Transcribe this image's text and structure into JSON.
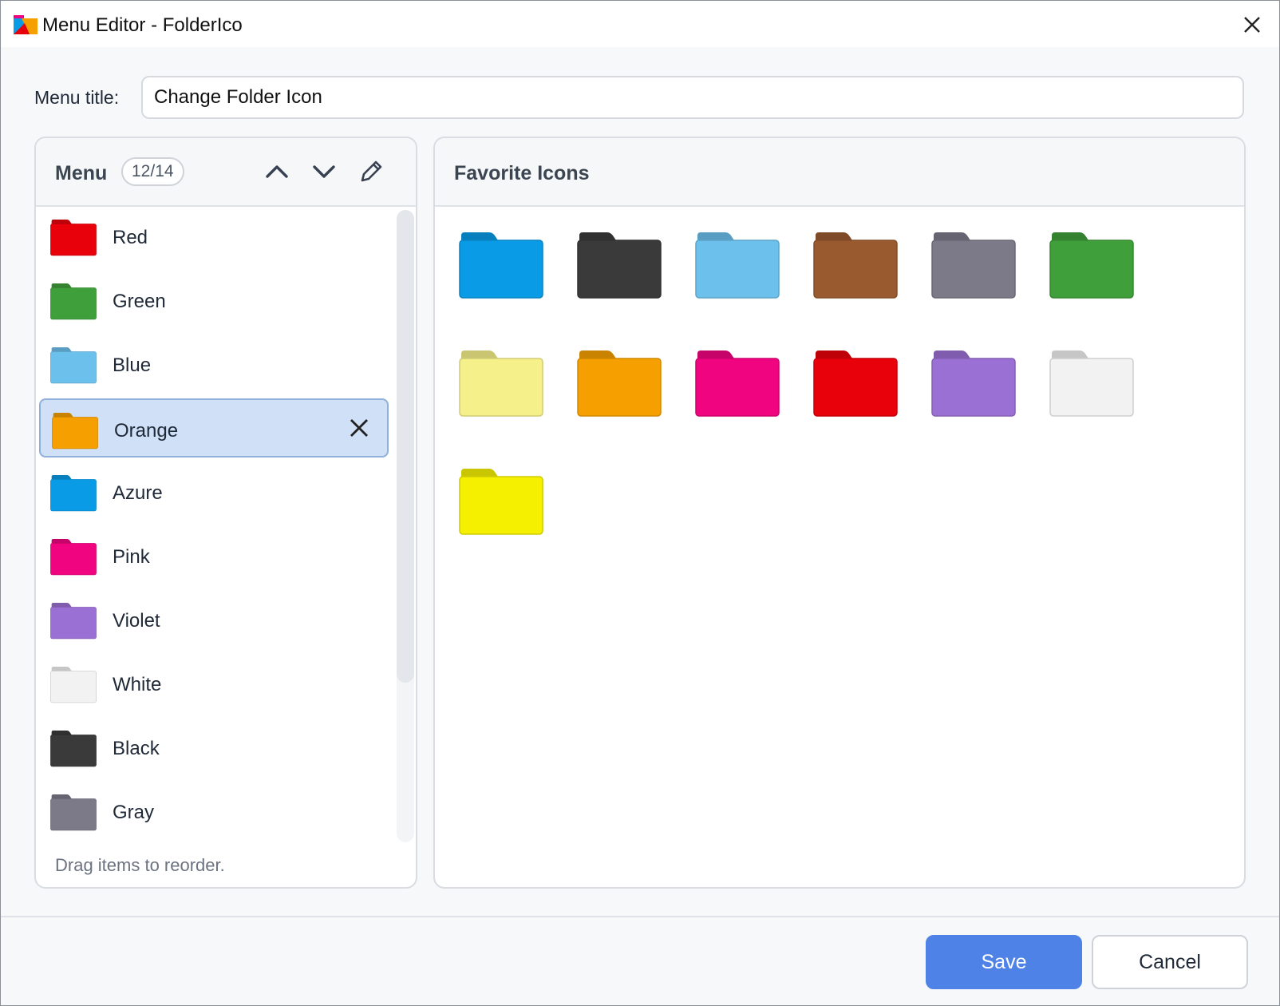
{
  "window": {
    "title": "Menu Editor - FolderIco",
    "close_icon": "close-icon"
  },
  "menu_title": {
    "label": "Menu title:",
    "value": "Change Folder Icon"
  },
  "menu_panel": {
    "header": "Menu",
    "count": "12/14",
    "icons": [
      "chevron-up-icon",
      "chevron-down-icon",
      "pencil-icon"
    ],
    "selected_index": 3,
    "items": [
      {
        "label": "Red",
        "color": "#e8000b"
      },
      {
        "label": "Green",
        "color": "#3f9f3a"
      },
      {
        "label": "Blue",
        "color": "#6cc1ec"
      },
      {
        "label": "Orange",
        "color": "#f5a000"
      },
      {
        "label": "Azure",
        "color": "#0a9be7"
      },
      {
        "label": "Pink",
        "color": "#f0047f"
      },
      {
        "label": "Violet",
        "color": "#9b70d4"
      },
      {
        "label": "White",
        "color": "#f2f2f2"
      },
      {
        "label": "Black",
        "color": "#3a3a3a"
      },
      {
        "label": "Gray",
        "color": "#7c7a88"
      }
    ],
    "hint": "Drag items to reorder."
  },
  "favorites_panel": {
    "header": "Favorite Icons",
    "icons": [
      {
        "color": "#0a9be7"
      },
      {
        "color": "#3a3a3a"
      },
      {
        "color": "#6cc1ec"
      },
      {
        "color": "#9a5a2f"
      },
      {
        "color": "#7c7a88"
      },
      {
        "color": "#3f9f3a"
      },
      {
        "color": "#f5f08a"
      },
      {
        "color": "#f5a000"
      },
      {
        "color": "#f0047f"
      },
      {
        "color": "#e8000b"
      },
      {
        "color": "#9b70d4"
      },
      {
        "color": "#f2f2f2"
      },
      {
        "color": "#f5f000"
      }
    ]
  },
  "footer": {
    "save_label": "Save",
    "cancel_label": "Cancel"
  }
}
